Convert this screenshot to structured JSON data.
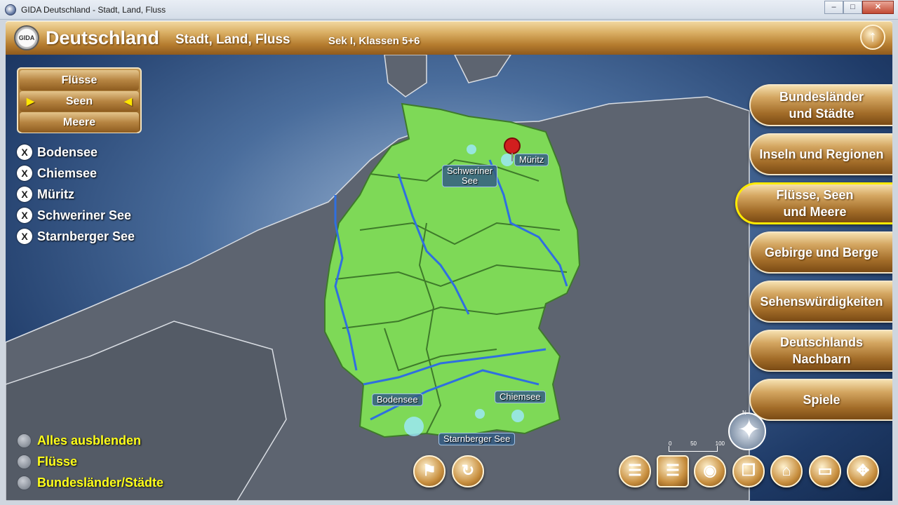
{
  "window": {
    "title": "GIDA Deutschland - Stadt, Land, Fluss",
    "minimize": "–",
    "maximize": "□",
    "close": "✕"
  },
  "header": {
    "logo": "GIDA",
    "app_name": "Deutschland",
    "subtitle": "Stadt, Land, Fluss",
    "grade": "Sek I, Klassen 5+6",
    "up_icon": "↑"
  },
  "categories": {
    "items": [
      "Flüsse",
      "Seen",
      "Meere"
    ],
    "active": "Seen",
    "arrow_left": "▶",
    "arrow_right": "◀"
  },
  "lakes": {
    "items": [
      "Bodensee",
      "Chiemsee",
      "Müritz",
      "Schweriner See",
      "Starnberger See"
    ],
    "mark": "X"
  },
  "map_labels": {
    "mueritz": "Müritz",
    "schwerin": "Schweriner\nSee",
    "bodensee": "Bodensee",
    "chiemsee": "Chiemsee",
    "starnberg": "Starnberger See"
  },
  "toggles": [
    "Alles ausblenden",
    "Flüsse",
    "Bundesländer/Städte"
  ],
  "menu": [
    {
      "label": "Bundesländer\nund Städte",
      "active": false
    },
    {
      "label": "Inseln und Regionen",
      "active": false
    },
    {
      "label": "Flüsse, Seen\nund Meere",
      "active": true
    },
    {
      "label": "Gebirge und Berge",
      "active": false
    },
    {
      "label": "Sehenswürdigkeiten",
      "active": false
    },
    {
      "label": "Deutschlands\nNachbarn",
      "active": false
    },
    {
      "label": "Spiele",
      "active": false
    }
  ],
  "scale": {
    "labels": [
      "0",
      "50",
      "100"
    ]
  },
  "compass": {
    "north": "N"
  },
  "icons": {
    "center_left": "pin-icon",
    "center_right": "reset-icon",
    "tools": [
      "list-icon",
      "list-icon",
      "camera-icon",
      "copy-icon",
      "home-icon",
      "window-icon",
      "move-icon"
    ]
  },
  "colors": {
    "gold": "#c88f3f",
    "accent": "#ffea00",
    "land": "#7ed957",
    "water": "#2f6fe0"
  }
}
